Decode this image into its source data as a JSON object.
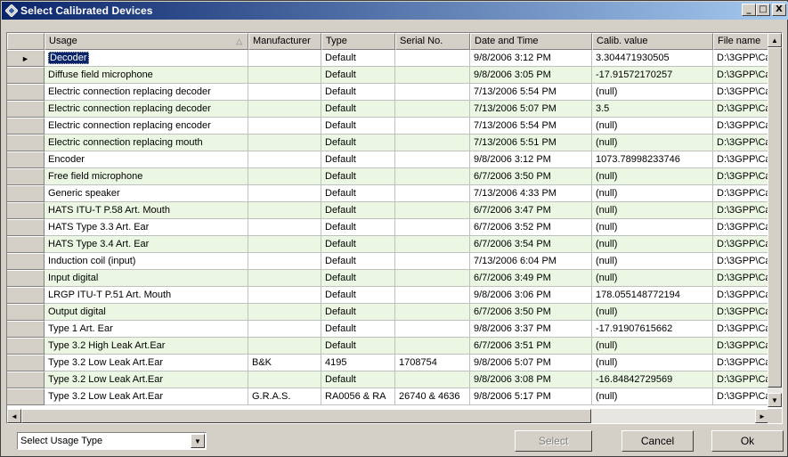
{
  "window": {
    "title": "Select Calibrated Devices",
    "min_label": "_",
    "max_label": "□",
    "close_label": "X"
  },
  "grid": {
    "columns": [
      "Usage",
      "Manufacturer",
      "Type",
      "Serial No.",
      "Date and Time",
      "Calib. value",
      "File name"
    ],
    "rows": [
      [
        "Decoder",
        "",
        "Default",
        "",
        "9/8/2006 3:12 PM",
        "3.304471930505",
        "D:\\3GPP\\Ca"
      ],
      [
        "Diffuse field microphone",
        "",
        "Default",
        "",
        "9/8/2006 3:05 PM",
        "-17.91572170257",
        "D:\\3GPP\\Ca"
      ],
      [
        "Electric connection replacing decoder",
        "",
        "Default",
        "",
        "7/13/2006 5:54 PM",
        "(null)",
        "D:\\3GPP\\Ca"
      ],
      [
        "Electric connection replacing decoder",
        "",
        "Default",
        "",
        "7/13/2006 5:07 PM",
        "3.5",
        "D:\\3GPP\\Ca"
      ],
      [
        "Electric connection replacing encoder",
        "",
        "Default",
        "",
        "7/13/2006 5:54 PM",
        "(null)",
        "D:\\3GPP\\Ca"
      ],
      [
        "Electric connection replacing mouth",
        "",
        "Default",
        "",
        "7/13/2006 5:51 PM",
        "(null)",
        "D:\\3GPP\\Ca"
      ],
      [
        "Encoder",
        "",
        "Default",
        "",
        "9/8/2006 3:12 PM",
        "1073.78998233746",
        "D:\\3GPP\\Ca"
      ],
      [
        "Free field microphone",
        "",
        "Default",
        "",
        "6/7/2006 3:50 PM",
        "(null)",
        "D:\\3GPP\\Ca"
      ],
      [
        "Generic speaker",
        "",
        "Default",
        "",
        "7/13/2006 4:33 PM",
        "(null)",
        "D:\\3GPP\\Ca"
      ],
      [
        "HATS ITU-T P.58 Art. Mouth",
        "",
        "Default",
        "",
        "6/7/2006 3:47 PM",
        "(null)",
        "D:\\3GPP\\Ca"
      ],
      [
        "HATS Type 3.3 Art. Ear",
        "",
        "Default",
        "",
        "6/7/2006 3:52 PM",
        "(null)",
        "D:\\3GPP\\Ca"
      ],
      [
        "HATS Type 3.4 Art. Ear",
        "",
        "Default",
        "",
        "6/7/2006 3:54 PM",
        "(null)",
        "D:\\3GPP\\Ca"
      ],
      [
        "Induction coil (input)",
        "",
        "Default",
        "",
        "7/13/2006 6:04 PM",
        "(null)",
        "D:\\3GPP\\Ca"
      ],
      [
        "Input digital",
        "",
        "Default",
        "",
        "6/7/2006 3:49 PM",
        "(null)",
        "D:\\3GPP\\Ca"
      ],
      [
        "LRGP ITU-T P.51 Art. Mouth",
        "",
        "Default",
        "",
        "9/8/2006 3:06 PM",
        "178.055148772194",
        "D:\\3GPP\\Ca"
      ],
      [
        "Output digital",
        "",
        "Default",
        "",
        "6/7/2006 3:50 PM",
        "(null)",
        "D:\\3GPP\\Ca"
      ],
      [
        "Type 1 Art. Ear",
        "",
        "Default",
        "",
        "9/8/2006 3:37 PM",
        "-17.91907615662",
        "D:\\3GPP\\Ca"
      ],
      [
        "Type 3.2 High Leak Art.Ear",
        "",
        "Default",
        "",
        "6/7/2006 3:51 PM",
        "(null)",
        "D:\\3GPP\\Ca"
      ],
      [
        "Type 3.2 Low Leak Art.Ear",
        "B&K",
        "4195",
        "1708754",
        "9/8/2006 5:07 PM",
        "(null)",
        "D:\\3GPP\\Ca"
      ],
      [
        "Type 3.2 Low Leak Art.Ear",
        "",
        "Default",
        "",
        "9/8/2006 3:08 PM",
        "-16.84842729569",
        "D:\\3GPP\\Ca"
      ],
      [
        "Type 3.2 Low Leak Art.Ear",
        "G.R.A.S.",
        "RA0056 & RA",
        "26740 & 4636",
        "9/8/2006 5:17 PM",
        "(null)",
        "D:\\3GPP\\Ca"
      ]
    ]
  },
  "footer": {
    "usage_select_value": "Select Usage Type",
    "select_label": "Select",
    "cancel_label": "Cancel",
    "ok_label": "Ok"
  },
  "colors": {
    "title_start": "#0a246a",
    "title_end": "#a6caf0",
    "alt_row": "#ebf7e3",
    "selection": "#0a246a"
  },
  "icons": {
    "title": "diamond-device-icon",
    "row_pointer": "triangle-right-icon",
    "dropdown": "chevron-down-icon"
  }
}
